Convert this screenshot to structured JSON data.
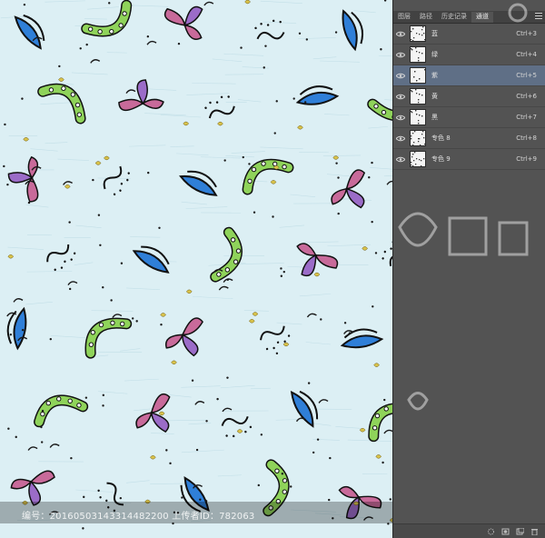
{
  "panel": {
    "tabs": [
      {
        "label": "图层",
        "active": false
      },
      {
        "label": "路径",
        "active": false
      },
      {
        "label": "历史记录",
        "active": false
      },
      {
        "label": "通道",
        "active": true
      }
    ],
    "close_glyph": "×",
    "channels": [
      {
        "name": "蓝",
        "shortcut": "Ctrl+3",
        "selected": false
      },
      {
        "name": "绿",
        "shortcut": "Ctrl+4",
        "selected": false
      },
      {
        "name": "紫",
        "shortcut": "Ctrl+5",
        "selected": true
      },
      {
        "name": "黄",
        "shortcut": "Ctrl+6",
        "selected": false
      },
      {
        "name": "黑",
        "shortcut": "Ctrl+7",
        "selected": false
      },
      {
        "name": "专色 8",
        "shortcut": "Ctrl+8",
        "selected": false
      },
      {
        "name": "专色 9",
        "shortcut": "Ctrl+9",
        "selected": false
      }
    ],
    "bottom_icons": [
      "load-selection-icon",
      "save-selection-icon",
      "new-channel-icon",
      "trash-icon"
    ]
  },
  "watermark": {
    "text": "编号：20160503143314482200 上传者ID：782063"
  },
  "colors": {
    "canvas_bg": "#dceff4",
    "panel_bg": "#535353",
    "selected_row": "#5f6f86",
    "pattern_green": "#8fd35a",
    "pattern_blue": "#2f7fd8",
    "pattern_pink": "#c86a9a",
    "pattern_purple": "#9b6cc8"
  }
}
